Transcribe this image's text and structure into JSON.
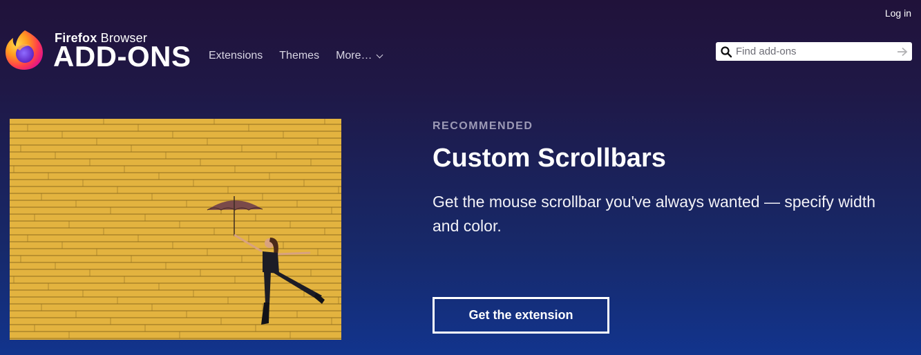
{
  "header": {
    "brand_small_bold": "Firefox",
    "brand_small_regular": " Browser",
    "brand_big": "ADD-ONS",
    "login_label": "Log in",
    "nav": [
      {
        "label": "Extensions"
      },
      {
        "label": "Themes"
      },
      {
        "label": "More…"
      }
    ],
    "search": {
      "placeholder": "Find add-ons",
      "value": ""
    }
  },
  "hero": {
    "eyebrow": "RECOMMENDED",
    "title": "Custom Scrollbars",
    "description": "Get the mouse scrollbar you've always wanted — specify width and color.",
    "cta_label": "Get the extension"
  },
  "colors": {
    "background_top": "#20123a",
    "background_bottom": "#12348d",
    "image_wall": "#e3b33f"
  },
  "icons": {
    "logo": "firefox-logo-icon",
    "search": "search-icon",
    "search_submit": "arrow-right-icon",
    "more_chevron": "chevron-down-icon"
  }
}
